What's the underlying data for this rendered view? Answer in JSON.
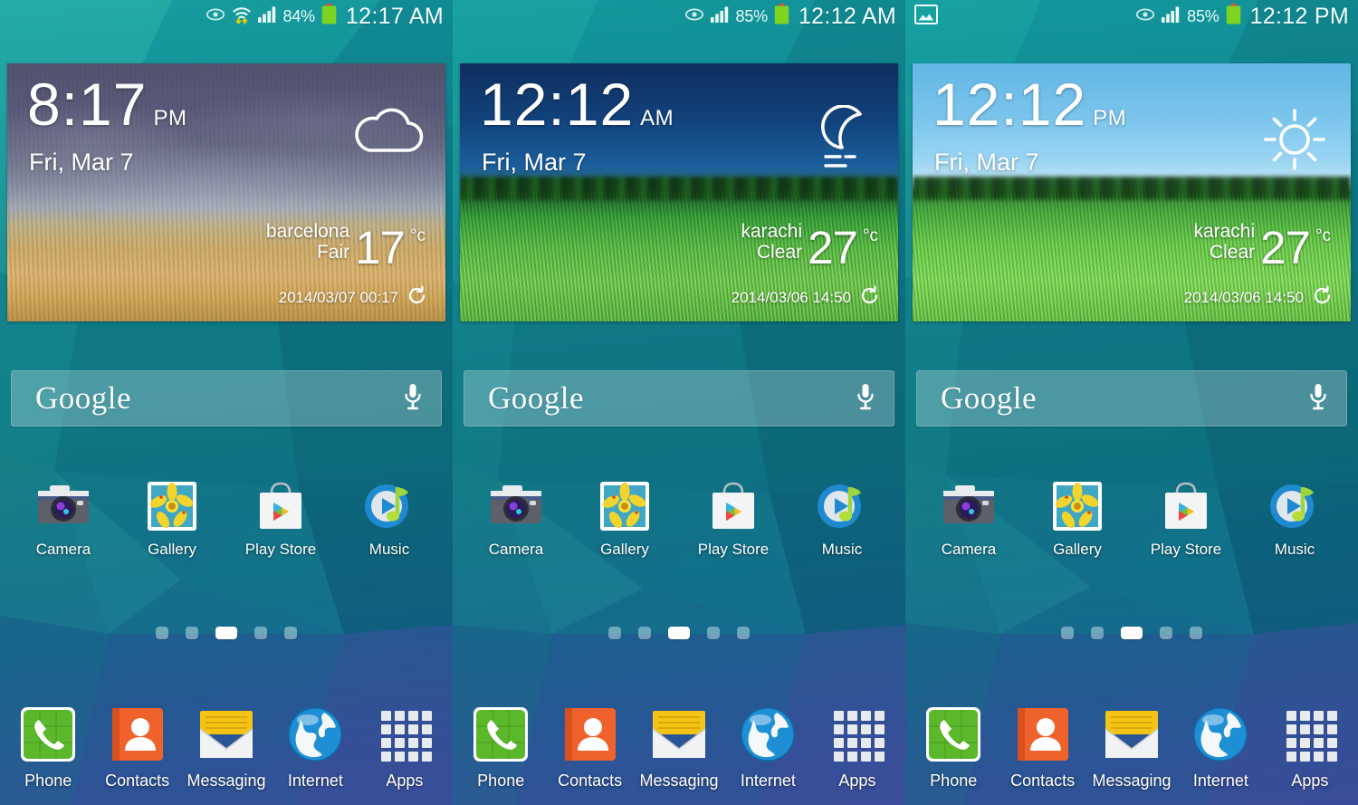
{
  "panels": [
    {
      "id": "panel-1",
      "statusbar": {
        "clock": "12:17 AM",
        "battery_pct": "84%",
        "icons": [
          "smart-stay-eye-icon",
          "wifi-icon",
          "signal-bars-icon",
          "battery-icon"
        ]
      },
      "widget": {
        "time": "8:17",
        "ampm": "PM",
        "date": "Fri, Mar 7",
        "city": "barcelona",
        "condition": "Fair",
        "temp": "17",
        "unit": "°c",
        "updated": "2014/03/07 00:17",
        "weather_icon": "cloud-icon",
        "scene": "wheat-field"
      },
      "search": {
        "logo": "Google",
        "mic": "microphone-icon"
      },
      "apps": [
        {
          "label": "Camera",
          "icon": "camera-icon"
        },
        {
          "label": "Gallery",
          "icon": "gallery-icon"
        },
        {
          "label": "Play Store",
          "icon": "play-store-icon"
        },
        {
          "label": "Music",
          "icon": "music-icon"
        }
      ],
      "dots": {
        "count": 5,
        "active": 2
      },
      "dock": [
        {
          "label": "Phone",
          "icon": "phone-icon"
        },
        {
          "label": "Contacts",
          "icon": "contacts-icon"
        },
        {
          "label": "Messaging",
          "icon": "messaging-icon"
        },
        {
          "label": "Internet",
          "icon": "internet-icon"
        },
        {
          "label": "Apps",
          "icon": "apps-grid-icon"
        }
      ]
    },
    {
      "id": "panel-2",
      "statusbar": {
        "clock": "12:12 AM",
        "battery_pct": "85%",
        "icons": [
          "smart-stay-eye-icon",
          "signal-bars-icon",
          "battery-icon"
        ]
      },
      "widget": {
        "time": "12:12",
        "ampm": "AM",
        "date": "Fri, Mar 7",
        "city": "karachi",
        "condition": "Clear",
        "temp": "27",
        "unit": "°c",
        "updated": "2014/03/06 14:50",
        "weather_icon": "moon-haze-icon",
        "scene": "night-grass"
      },
      "search": {
        "logo": "Google",
        "mic": "microphone-icon"
      },
      "apps": [
        {
          "label": "Camera",
          "icon": "camera-icon"
        },
        {
          "label": "Gallery",
          "icon": "gallery-icon"
        },
        {
          "label": "Play Store",
          "icon": "play-store-icon"
        },
        {
          "label": "Music",
          "icon": "music-icon"
        }
      ],
      "dots": {
        "count": 5,
        "active": 2
      },
      "dock": [
        {
          "label": "Phone",
          "icon": "phone-icon"
        },
        {
          "label": "Contacts",
          "icon": "contacts-icon"
        },
        {
          "label": "Messaging",
          "icon": "messaging-icon"
        },
        {
          "label": "Internet",
          "icon": "internet-icon"
        },
        {
          "label": "Apps",
          "icon": "apps-grid-icon"
        }
      ]
    },
    {
      "id": "panel-3",
      "statusbar": {
        "clock": "12:12 PM",
        "battery_pct": "85%",
        "icons": [
          "screenshot-image-icon",
          "smart-stay-eye-icon",
          "signal-bars-icon",
          "battery-icon"
        ]
      },
      "widget": {
        "time": "12:12",
        "ampm": "PM",
        "date": "Fri, Mar 7",
        "city": "karachi",
        "condition": "Clear",
        "temp": "27",
        "unit": "°c",
        "updated": "2014/03/06 14:50",
        "weather_icon": "sun-icon",
        "scene": "day-grass"
      },
      "search": {
        "logo": "Google",
        "mic": "microphone-icon"
      },
      "apps": [
        {
          "label": "Camera",
          "icon": "camera-icon"
        },
        {
          "label": "Gallery",
          "icon": "gallery-icon"
        },
        {
          "label": "Play Store",
          "icon": "play-store-icon"
        },
        {
          "label": "Music",
          "icon": "music-icon"
        }
      ],
      "dots": {
        "count": 5,
        "active": 2
      },
      "dock": [
        {
          "label": "Phone",
          "icon": "phone-icon"
        },
        {
          "label": "Contacts",
          "icon": "contacts-icon"
        },
        {
          "label": "Messaging",
          "icon": "messaging-icon"
        },
        {
          "label": "Internet",
          "icon": "internet-icon"
        },
        {
          "label": "Apps",
          "icon": "apps-grid-icon"
        }
      ]
    }
  ],
  "colors": {
    "wallpaper_teal": "#0e7c86",
    "wallpaper_blue": "#3b4b96",
    "status_text": "#f2fffe",
    "battery_green": "#7ed321",
    "phone_green": "#5bb82a",
    "contacts_orange": "#f0622b",
    "messaging_yellow": "#f4c314",
    "internet_blue": "#1e8fd5",
    "music_blue": "#1f8ad0"
  }
}
